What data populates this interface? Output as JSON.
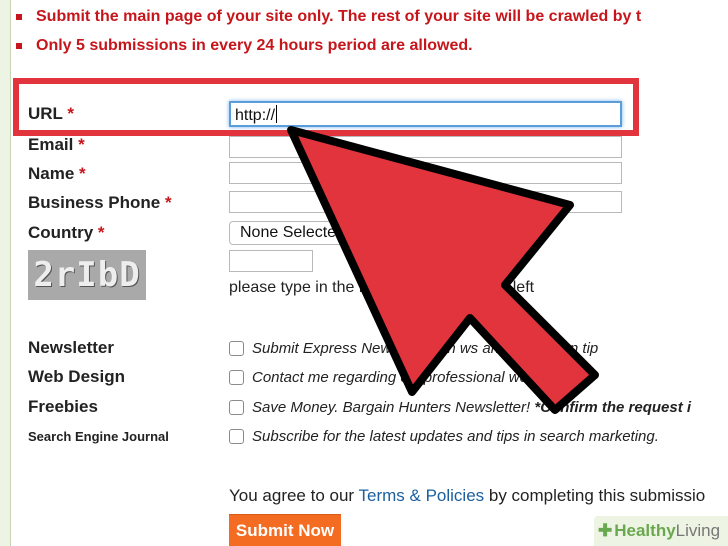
{
  "notices": [
    "Submit the main page of your site only. The rest of your site will be crawled by t",
    "Only 5 submissions in every 24 hours period are allowed."
  ],
  "form": {
    "url": {
      "label": "URL",
      "required_mark": "*",
      "value": "http://"
    },
    "email": {
      "label": "Email",
      "required_mark": "*"
    },
    "name": {
      "label": "Name",
      "required_mark": "*"
    },
    "phone": {
      "label": "Business Phone",
      "required_mark": "*"
    },
    "country": {
      "label": "Country",
      "required_mark": "*",
      "selected": "None Selecte"
    },
    "captcha": {
      "image_text": "2rIbD",
      "hint": "please type in the                               n in the image on the left"
    }
  },
  "checkboxes": [
    {
      "label": "Newsletter",
      "text": "Submit Express New         r. Search                   ws and promotion tip",
      "bold": ""
    },
    {
      "label": "Web Design",
      "text": "Contact me regarding       ew professional web design.",
      "bold": ""
    },
    {
      "label": "Freebies",
      "text": "Save Money. Bargain Hunters Newsletter! ",
      "bold": "*Confirm the request i"
    },
    {
      "label": "Search Engine Journal",
      "text": "Subscribe for the latest updates and tips in search marketing.",
      "bold": ""
    }
  ],
  "agreement": {
    "prefix": "You agree to our ",
    "link": "Terms & Policies",
    "suffix": " by completing this submissio"
  },
  "submit_label": "Submit Now",
  "watermark": {
    "part1": "Healthy",
    "part2": "Living"
  },
  "colors": {
    "highlight": "#e2343d",
    "notice": "#c6161b",
    "submit": "#f36c21",
    "link": "#1b5f9e"
  }
}
